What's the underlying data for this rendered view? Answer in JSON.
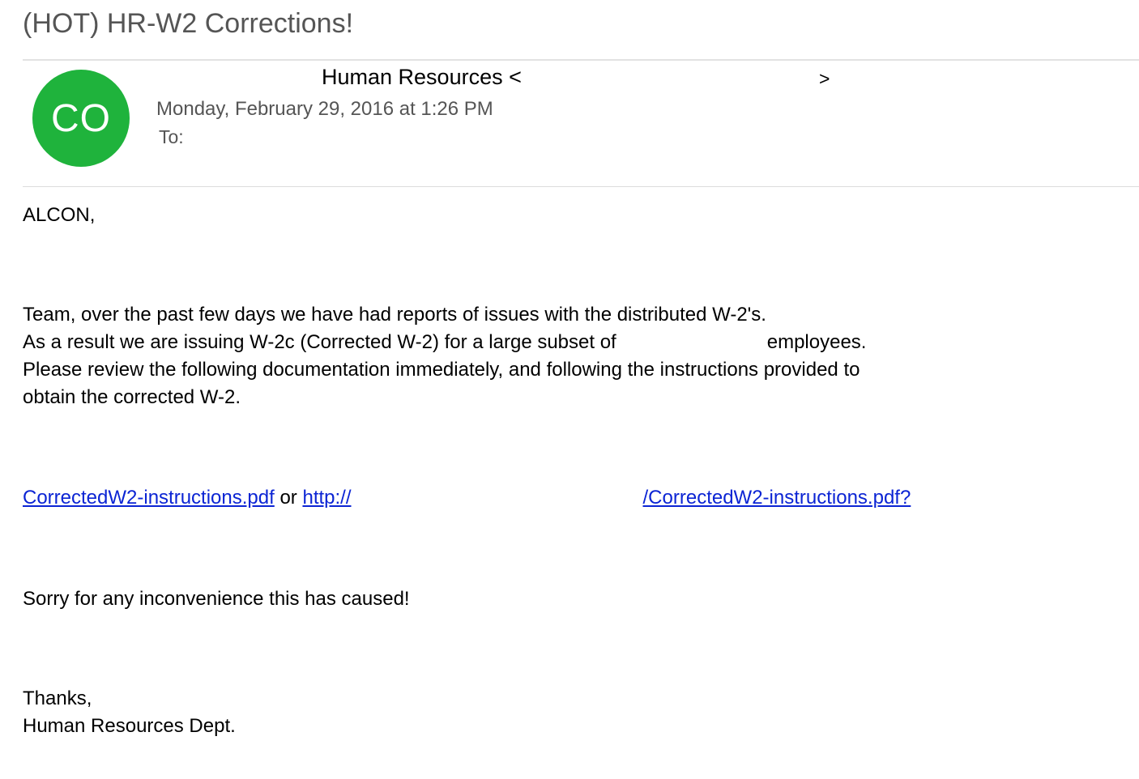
{
  "email": {
    "subject": "(HOT) HR-W2 Corrections!",
    "avatar_initials": "CO",
    "avatar_color": "#1fb33c",
    "from_name": "Human Resources <",
    "from_close": ">",
    "date": "Monday, February 29, 2016 at 1:26 PM",
    "to_label": "To:"
  },
  "body": {
    "greeting": "ALCON,",
    "line1": "Team, over the past few days we have had reports of issues with the distributed W-2's.",
    "line2_part1": "As a result we are issuing W-2c (Corrected W-2) for a large subset of",
    "line2_part2": "employees.",
    "line3": "Please review the following documentation immediately, and following the instructions provided to",
    "line4": "obtain the corrected W-2.",
    "link1": "CorrectedW2-instructions.pdf",
    "link_or": " or ",
    "link2_start": "http://",
    "link2_end": "/CorrectedW2-instructions.pdf?",
    "sorry": "Sorry for any inconvenience this has caused!",
    "thanks": "Thanks,",
    "signature": "Human Resources Dept."
  },
  "colors": {
    "link": "#0b24d4",
    "meta_text": "#555555"
  }
}
